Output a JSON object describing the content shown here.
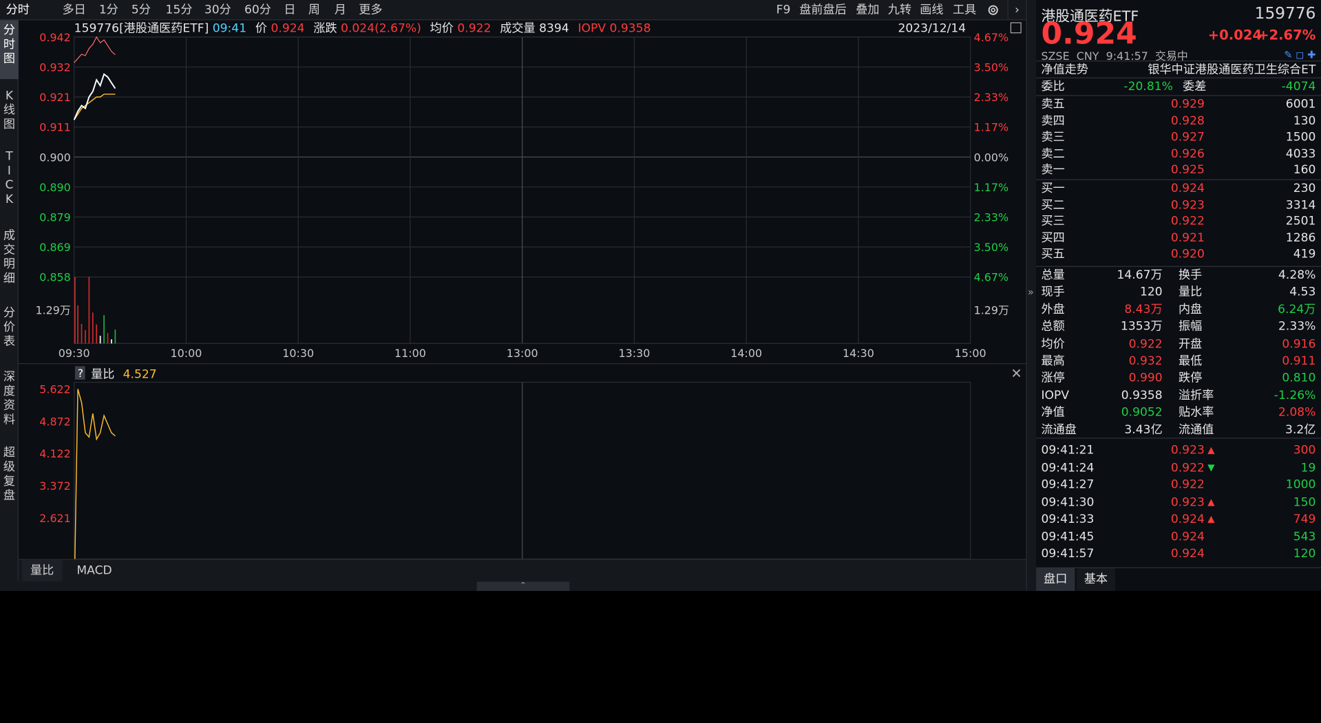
{
  "period_tabs": [
    "分时",
    "多日",
    "1分",
    "5分",
    "15分",
    "30分",
    "60分",
    "日",
    "周",
    "月",
    "更多"
  ],
  "period_active": 0,
  "toolbar_right": [
    "F9",
    "盘前盘后",
    "叠加",
    "九转",
    "画线",
    "工具"
  ],
  "left_nav": [
    {
      "label": "分\n时\n图",
      "active": true
    },
    {
      "label": "K\n线\n图"
    },
    {
      "label": "T\nI\nC\nK"
    },
    {
      "label": "成\n交\n明\n细"
    },
    {
      "label": "分\n价\n表"
    },
    {
      "label": "深\n度\n资\n料"
    },
    {
      "label": "超\n级\n复\n盘"
    }
  ],
  "info": {
    "code_name": "159776[港股通医药ETF]",
    "time": "09:41",
    "price_label": "价",
    "price": "0.924",
    "change_label": "涨跌",
    "change": "0.024(2.67%)",
    "avg_label": "均价",
    "avg": "0.922",
    "vol_label": "成交量",
    "vol": "8394",
    "iopv_label": "IOPV",
    "iopv": "0.9358",
    "date": "2023/12/14"
  },
  "price_axis_left": [
    "0.942",
    "0.932",
    "0.921",
    "0.911",
    "0.900",
    "0.890",
    "0.879",
    "0.869",
    "0.858"
  ],
  "price_axis_right": [
    "4.67%",
    "3.50%",
    "2.33%",
    "1.17%",
    "0.00%",
    "1.17%",
    "2.33%",
    "3.50%",
    "4.67%"
  ],
  "vol_axis_label": "1.29万",
  "time_axis": [
    "09:30",
    "10:00",
    "10:30",
    "11:00",
    "13:00",
    "13:30",
    "14:00",
    "14:30",
    "15:00"
  ],
  "indicator": {
    "help": "?",
    "name": "量比",
    "value": "4.527",
    "axis": [
      "5.622",
      "4.872",
      "4.122",
      "3.372",
      "2.621"
    ]
  },
  "bottom_tabs": [
    "量比",
    "MACD"
  ],
  "chart_data": {
    "type": "line",
    "x": [
      "09:30",
      "09:31",
      "09:32",
      "09:33",
      "09:34",
      "09:35",
      "09:36",
      "09:37",
      "09:38",
      "09:39",
      "09:40",
      "09:41"
    ],
    "series": [
      {
        "name": "价",
        "values": [
          0.913,
          0.916,
          0.918,
          0.917,
          0.921,
          0.923,
          0.927,
          0.925,
          0.929,
          0.928,
          0.926,
          0.924
        ]
      },
      {
        "name": "均价",
        "values": [
          0.913,
          0.915,
          0.917,
          0.918,
          0.919,
          0.92,
          0.921,
          0.921,
          0.922,
          0.922,
          0.922,
          0.922
        ]
      },
      {
        "name": "IOPV",
        "values": [
          0.933,
          0.9345,
          0.936,
          0.9355,
          0.938,
          0.9395,
          0.942,
          0.94,
          0.941,
          0.939,
          0.937,
          0.9358
        ]
      }
    ],
    "volume": [
      12900,
      7400,
      3800,
      2600,
      12900,
      6000,
      3700,
      1500,
      5500,
      2000,
      800,
      2700
    ],
    "volume_dir": [
      "up",
      "up",
      "up",
      "up",
      "up",
      "up",
      "up",
      "flat",
      "down",
      "up",
      "flat",
      "down"
    ],
    "volume_ratio": [
      0.6,
      5.62,
      5.3,
      4.6,
      4.5,
      5.05,
      4.45,
      4.6,
      5.0,
      4.8,
      4.6,
      4.527
    ],
    "ylim": [
      0.858,
      0.942
    ],
    "ref_price": 0.9
  },
  "quote": {
    "name": "港股通医药ETF",
    "code": "159776",
    "price": "0.924",
    "change": "+0.024",
    "pct": "+2.67%",
    "exchange": "SZSE",
    "currency": "CNY",
    "time": "9:41:57",
    "status": "交易中",
    "nav_trend": "净值走势",
    "index_name": "银华中证港股通医药卫生综合ET"
  },
  "weibi": {
    "label": "委比",
    "value": "-20.81%",
    "label2": "委差",
    "value2": "-4074"
  },
  "asks": [
    {
      "label": "卖五",
      "price": "0.929",
      "vol": "6001"
    },
    {
      "label": "卖四",
      "price": "0.928",
      "vol": "130"
    },
    {
      "label": "卖三",
      "price": "0.927",
      "vol": "1500"
    },
    {
      "label": "卖二",
      "price": "0.926",
      "vol": "4033"
    },
    {
      "label": "卖一",
      "price": "0.925",
      "vol": "160"
    }
  ],
  "bids": [
    {
      "label": "买一",
      "price": "0.924",
      "vol": "230"
    },
    {
      "label": "买二",
      "price": "0.923",
      "vol": "3314"
    },
    {
      "label": "买三",
      "price": "0.922",
      "vol": "2501"
    },
    {
      "label": "买四",
      "price": "0.921",
      "vol": "1286"
    },
    {
      "label": "买五",
      "price": "0.920",
      "vol": "419"
    }
  ],
  "stats": [
    [
      {
        "label": "总量",
        "value": "14.67万",
        "color": "white"
      },
      {
        "label": "换手",
        "value": "4.28%",
        "color": "white"
      }
    ],
    [
      {
        "label": "现手",
        "value": "120",
        "color": "white"
      },
      {
        "label": "量比",
        "value": "4.53",
        "color": "white"
      }
    ],
    [
      {
        "label": "外盘",
        "value": "8.43万",
        "color": "red"
      },
      {
        "label": "内盘",
        "value": "6.24万",
        "color": "green"
      }
    ],
    [
      {
        "label": "总额",
        "value": "1353万",
        "color": "white"
      },
      {
        "label": "振幅",
        "value": "2.33%",
        "color": "white"
      }
    ],
    [
      {
        "label": "均价",
        "value": "0.922",
        "color": "red"
      },
      {
        "label": "开盘",
        "value": "0.916",
        "color": "red"
      }
    ],
    [
      {
        "label": "最高",
        "value": "0.932",
        "color": "red"
      },
      {
        "label": "最低",
        "value": "0.911",
        "color": "red"
      }
    ],
    [
      {
        "label": "涨停",
        "value": "0.990",
        "color": "red"
      },
      {
        "label": "跌停",
        "value": "0.810",
        "color": "green"
      }
    ],
    [
      {
        "label": "IOPV",
        "value": "0.9358",
        "color": "white"
      },
      {
        "label": "溢折率",
        "value": "-1.26%",
        "color": "green"
      }
    ],
    [
      {
        "label": "净值",
        "value": "0.9052",
        "color": "green"
      },
      {
        "label": "贴水率",
        "value": "2.08%",
        "color": "red"
      }
    ],
    [
      {
        "label": "流通盘",
        "value": "3.43亿",
        "color": "white"
      },
      {
        "label": "流通值",
        "value": "3.2亿",
        "color": "white"
      }
    ]
  ],
  "ticks": [
    {
      "time": "09:41:21",
      "price": "0.923",
      "dir": "up",
      "vol": "300",
      "volc": "red"
    },
    {
      "time": "09:41:24",
      "price": "0.922",
      "dir": "down",
      "vol": "19",
      "volc": "green"
    },
    {
      "time": "09:41:27",
      "price": "0.922",
      "dir": "",
      "vol": "1000",
      "volc": "green"
    },
    {
      "time": "09:41:30",
      "price": "0.923",
      "dir": "up",
      "vol": "150",
      "volc": "green"
    },
    {
      "time": "09:41:33",
      "price": "0.924",
      "dir": "up",
      "vol": "749",
      "volc": "red"
    },
    {
      "time": "09:41:45",
      "price": "0.924",
      "dir": "",
      "vol": "543",
      "volc": "green"
    },
    {
      "time": "09:41:57",
      "price": "0.924",
      "dir": "",
      "vol": "120",
      "volc": "green"
    }
  ],
  "panel_tabs": [
    "盘口",
    "基本"
  ],
  "colors": {
    "up": "#ff3b3b",
    "down": "#1fce45",
    "price_line": "#ffffff",
    "avg_line": "#ffbd2e",
    "iopv_line": "#ff6b6b",
    "grid": "#2a2d33"
  }
}
